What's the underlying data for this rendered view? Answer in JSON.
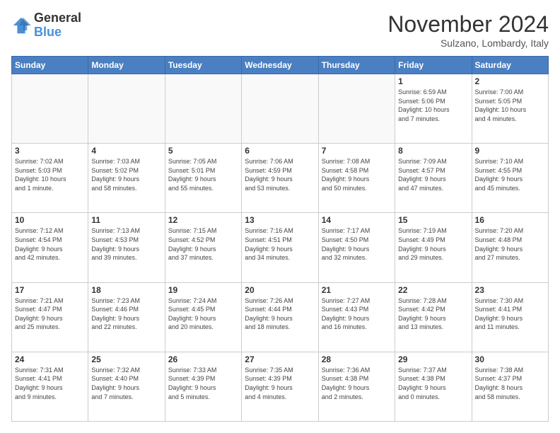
{
  "logo": {
    "line1": "General",
    "line2": "Blue"
  },
  "title": "November 2024",
  "subtitle": "Sulzano, Lombardy, Italy",
  "headers": [
    "Sunday",
    "Monday",
    "Tuesday",
    "Wednesday",
    "Thursday",
    "Friday",
    "Saturday"
  ],
  "weeks": [
    [
      {
        "day": "",
        "info": ""
      },
      {
        "day": "",
        "info": ""
      },
      {
        "day": "",
        "info": ""
      },
      {
        "day": "",
        "info": ""
      },
      {
        "day": "",
        "info": ""
      },
      {
        "day": "1",
        "info": "Sunrise: 6:59 AM\nSunset: 5:06 PM\nDaylight: 10 hours\nand 7 minutes."
      },
      {
        "day": "2",
        "info": "Sunrise: 7:00 AM\nSunset: 5:05 PM\nDaylight: 10 hours\nand 4 minutes."
      }
    ],
    [
      {
        "day": "3",
        "info": "Sunrise: 7:02 AM\nSunset: 5:03 PM\nDaylight: 10 hours\nand 1 minute."
      },
      {
        "day": "4",
        "info": "Sunrise: 7:03 AM\nSunset: 5:02 PM\nDaylight: 9 hours\nand 58 minutes."
      },
      {
        "day": "5",
        "info": "Sunrise: 7:05 AM\nSunset: 5:01 PM\nDaylight: 9 hours\nand 55 minutes."
      },
      {
        "day": "6",
        "info": "Sunrise: 7:06 AM\nSunset: 4:59 PM\nDaylight: 9 hours\nand 53 minutes."
      },
      {
        "day": "7",
        "info": "Sunrise: 7:08 AM\nSunset: 4:58 PM\nDaylight: 9 hours\nand 50 minutes."
      },
      {
        "day": "8",
        "info": "Sunrise: 7:09 AM\nSunset: 4:57 PM\nDaylight: 9 hours\nand 47 minutes."
      },
      {
        "day": "9",
        "info": "Sunrise: 7:10 AM\nSunset: 4:55 PM\nDaylight: 9 hours\nand 45 minutes."
      }
    ],
    [
      {
        "day": "10",
        "info": "Sunrise: 7:12 AM\nSunset: 4:54 PM\nDaylight: 9 hours\nand 42 minutes."
      },
      {
        "day": "11",
        "info": "Sunrise: 7:13 AM\nSunset: 4:53 PM\nDaylight: 9 hours\nand 39 minutes."
      },
      {
        "day": "12",
        "info": "Sunrise: 7:15 AM\nSunset: 4:52 PM\nDaylight: 9 hours\nand 37 minutes."
      },
      {
        "day": "13",
        "info": "Sunrise: 7:16 AM\nSunset: 4:51 PM\nDaylight: 9 hours\nand 34 minutes."
      },
      {
        "day": "14",
        "info": "Sunrise: 7:17 AM\nSunset: 4:50 PM\nDaylight: 9 hours\nand 32 minutes."
      },
      {
        "day": "15",
        "info": "Sunrise: 7:19 AM\nSunset: 4:49 PM\nDaylight: 9 hours\nand 29 minutes."
      },
      {
        "day": "16",
        "info": "Sunrise: 7:20 AM\nSunset: 4:48 PM\nDaylight: 9 hours\nand 27 minutes."
      }
    ],
    [
      {
        "day": "17",
        "info": "Sunrise: 7:21 AM\nSunset: 4:47 PM\nDaylight: 9 hours\nand 25 minutes."
      },
      {
        "day": "18",
        "info": "Sunrise: 7:23 AM\nSunset: 4:46 PM\nDaylight: 9 hours\nand 22 minutes."
      },
      {
        "day": "19",
        "info": "Sunrise: 7:24 AM\nSunset: 4:45 PM\nDaylight: 9 hours\nand 20 minutes."
      },
      {
        "day": "20",
        "info": "Sunrise: 7:26 AM\nSunset: 4:44 PM\nDaylight: 9 hours\nand 18 minutes."
      },
      {
        "day": "21",
        "info": "Sunrise: 7:27 AM\nSunset: 4:43 PM\nDaylight: 9 hours\nand 16 minutes."
      },
      {
        "day": "22",
        "info": "Sunrise: 7:28 AM\nSunset: 4:42 PM\nDaylight: 9 hours\nand 13 minutes."
      },
      {
        "day": "23",
        "info": "Sunrise: 7:30 AM\nSunset: 4:41 PM\nDaylight: 9 hours\nand 11 minutes."
      }
    ],
    [
      {
        "day": "24",
        "info": "Sunrise: 7:31 AM\nSunset: 4:41 PM\nDaylight: 9 hours\nand 9 minutes."
      },
      {
        "day": "25",
        "info": "Sunrise: 7:32 AM\nSunset: 4:40 PM\nDaylight: 9 hours\nand 7 minutes."
      },
      {
        "day": "26",
        "info": "Sunrise: 7:33 AM\nSunset: 4:39 PM\nDaylight: 9 hours\nand 5 minutes."
      },
      {
        "day": "27",
        "info": "Sunrise: 7:35 AM\nSunset: 4:39 PM\nDaylight: 9 hours\nand 4 minutes."
      },
      {
        "day": "28",
        "info": "Sunrise: 7:36 AM\nSunset: 4:38 PM\nDaylight: 9 hours\nand 2 minutes."
      },
      {
        "day": "29",
        "info": "Sunrise: 7:37 AM\nSunset: 4:38 PM\nDaylight: 9 hours\nand 0 minutes."
      },
      {
        "day": "30",
        "info": "Sunrise: 7:38 AM\nSunset: 4:37 PM\nDaylight: 8 hours\nand 58 minutes."
      }
    ]
  ]
}
